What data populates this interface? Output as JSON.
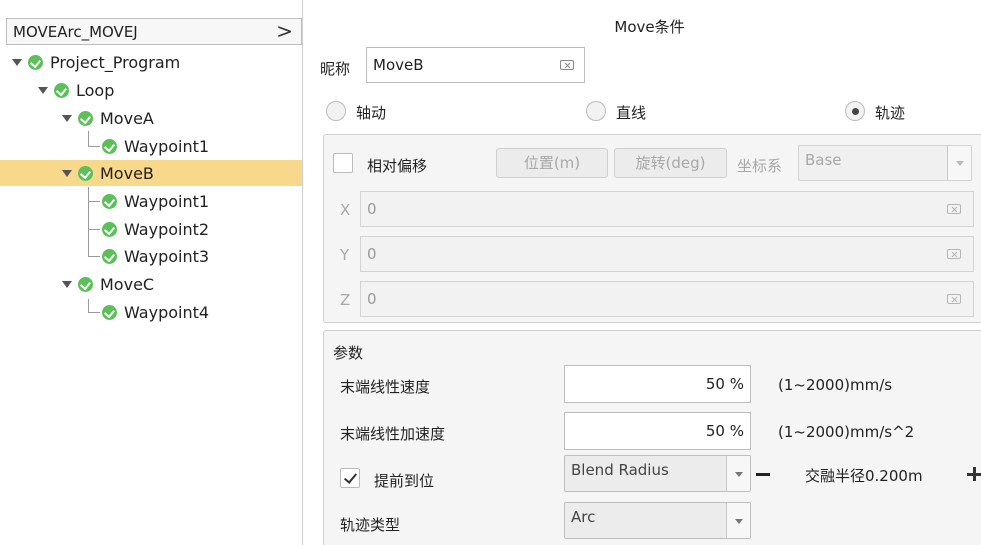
{
  "tree": {
    "header_label": "MOVEArc_MOVEJ",
    "header_arrow": ">",
    "nodes": [
      {
        "label": "Project_Program"
      },
      {
        "label": "Loop"
      },
      {
        "label": "MoveA"
      },
      {
        "label": "Waypoint1"
      },
      {
        "label": "MoveB"
      },
      {
        "label": "Waypoint1"
      },
      {
        "label": "Waypoint2"
      },
      {
        "label": "Waypoint3"
      },
      {
        "label": "MoveC"
      },
      {
        "label": "Waypoint4"
      }
    ],
    "selected": "MoveB"
  },
  "panel": {
    "title": "Move条件",
    "nickname_label": "昵称",
    "nickname_value": "MoveB",
    "move_types": [
      {
        "label": "轴动",
        "checked": false
      },
      {
        "label": "直线",
        "checked": false
      },
      {
        "label": "轨迹",
        "checked": true
      }
    ],
    "offset": {
      "relative_label": "相对偏移",
      "relative_checked": false,
      "position_button": "位置(m)",
      "rotation_button": "旋转(deg)",
      "coord_label": "坐标系",
      "coord_value": "Base",
      "x_label": "X",
      "x_value": "0",
      "y_label": "Y",
      "y_value": "0",
      "z_label": "Z",
      "z_value": "0"
    },
    "params": {
      "title": "参数",
      "linear_speed_label": "末端线性速度",
      "linear_speed_value": "50 %",
      "linear_speed_range": "(1~2000)mm/s",
      "linear_acc_label": "末端线性加速度",
      "linear_acc_value": "50 %",
      "linear_acc_range": "(1~2000)mm/s^2",
      "early_arrival_label": "提前到位",
      "early_arrival_checked": true,
      "blend_mode": "Blend Radius",
      "blend_radius_text": "交融半径0.200m",
      "trajectory_type_label": "轨迹类型",
      "trajectory_type_value": "Arc"
    }
  },
  "colors": {
    "selected_row": "#f8d98c",
    "check_green": "#5cc05a",
    "group_bg": "#f5f5f5"
  }
}
